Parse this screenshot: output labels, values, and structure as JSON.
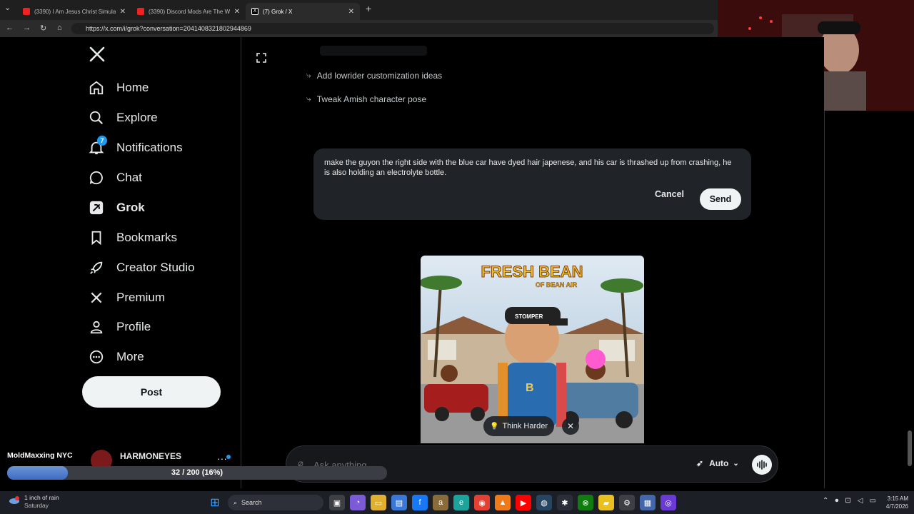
{
  "browser": {
    "tabs": [
      {
        "title": "(3390) I Am Jesus Christ Simulator",
        "active": false
      },
      {
        "title": "(3390) Discord Mods Are The Wo",
        "active": false
      },
      {
        "title": "(7) Grok / X",
        "active": true
      }
    ],
    "url": "https://x.com/i/grok?conversation=2041408321802944869"
  },
  "nav": {
    "items": [
      {
        "label": "Home",
        "icon": "home-icon"
      },
      {
        "label": "Explore",
        "icon": "search-icon"
      },
      {
        "label": "Notifications",
        "icon": "bell-icon",
        "badge": "7"
      },
      {
        "label": "Chat",
        "icon": "chat-bubble-icon"
      },
      {
        "label": "Grok",
        "icon": "grok-icon"
      },
      {
        "label": "Bookmarks",
        "icon": "bookmark-icon"
      },
      {
        "label": "Creator Studio",
        "icon": "rocket-icon"
      },
      {
        "label": "Premium",
        "icon": "x-logo-icon"
      },
      {
        "label": "Profile",
        "icon": "person-icon"
      },
      {
        "label": "More",
        "icon": "more-circle-icon"
      }
    ],
    "post_label": "Post"
  },
  "grok": {
    "suggestions": [
      "Add lowrider customization ideas",
      "Tweak Amish character pose"
    ],
    "edit": {
      "text": "make the guyon the right side with the blue car have dyed hair japenese, and his car is thrashed up from crashing, he is also holding an electrolyte bottle.",
      "cancel_label": "Cancel",
      "send_label": "Send"
    },
    "image": {
      "title_line1": "FRESH BEAN",
      "title_line2": "OF BEAN AIR",
      "hat_text": "STOMPER",
      "shirt_letter": "B"
    },
    "think_harder_label": "Think Harder",
    "ask_placeholder": "Ask anything",
    "mode_label": "Auto"
  },
  "overlay": {
    "account_name": "MoldMaxxing NYC",
    "user_name": "HARMONEYES",
    "progress_text": "32 / 200 (16%)",
    "progress_fraction": 0.16
  },
  "taskbar": {
    "weather_title": "1 inch of rain",
    "weather_sub": "Saturday",
    "search_label": "Search",
    "time": "3:15 AM",
    "date": "4/7/2026"
  },
  "colors": {
    "accent_blue": "#1d9bf0",
    "button_light": "#eff3f4",
    "panel": "#202327"
  }
}
